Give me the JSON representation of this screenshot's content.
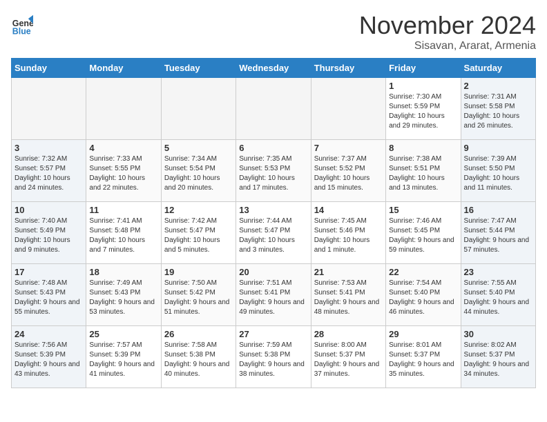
{
  "logo": {
    "line1": "General",
    "line2": "Blue"
  },
  "title": "November 2024",
  "location": "Sisavan, Ararat, Armenia",
  "days_of_week": [
    "Sunday",
    "Monday",
    "Tuesday",
    "Wednesday",
    "Thursday",
    "Friday",
    "Saturday"
  ],
  "weeks": [
    [
      {
        "day": "",
        "info": "",
        "type": "empty"
      },
      {
        "day": "",
        "info": "",
        "type": "empty"
      },
      {
        "day": "",
        "info": "",
        "type": "empty"
      },
      {
        "day": "",
        "info": "",
        "type": "empty"
      },
      {
        "day": "",
        "info": "",
        "type": "empty"
      },
      {
        "day": "1",
        "info": "Sunrise: 7:30 AM\nSunset: 5:59 PM\nDaylight: 10 hours and 29 minutes.",
        "type": "weekend"
      },
      {
        "day": "2",
        "info": "Sunrise: 7:31 AM\nSunset: 5:58 PM\nDaylight: 10 hours and 26 minutes.",
        "type": "weekend"
      }
    ],
    [
      {
        "day": "3",
        "info": "Sunrise: 7:32 AM\nSunset: 5:57 PM\nDaylight: 10 hours and 24 minutes.",
        "type": "weekend"
      },
      {
        "day": "4",
        "info": "Sunrise: 7:33 AM\nSunset: 5:55 PM\nDaylight: 10 hours and 22 minutes.",
        "type": "weekday"
      },
      {
        "day": "5",
        "info": "Sunrise: 7:34 AM\nSunset: 5:54 PM\nDaylight: 10 hours and 20 minutes.",
        "type": "weekday"
      },
      {
        "day": "6",
        "info": "Sunrise: 7:35 AM\nSunset: 5:53 PM\nDaylight: 10 hours and 17 minutes.",
        "type": "weekday"
      },
      {
        "day": "7",
        "info": "Sunrise: 7:37 AM\nSunset: 5:52 PM\nDaylight: 10 hours and 15 minutes.",
        "type": "weekday"
      },
      {
        "day": "8",
        "info": "Sunrise: 7:38 AM\nSunset: 5:51 PM\nDaylight: 10 hours and 13 minutes.",
        "type": "weekend"
      },
      {
        "day": "9",
        "info": "Sunrise: 7:39 AM\nSunset: 5:50 PM\nDaylight: 10 hours and 11 minutes.",
        "type": "weekend"
      }
    ],
    [
      {
        "day": "10",
        "info": "Sunrise: 7:40 AM\nSunset: 5:49 PM\nDaylight: 10 hours and 9 minutes.",
        "type": "weekend"
      },
      {
        "day": "11",
        "info": "Sunrise: 7:41 AM\nSunset: 5:48 PM\nDaylight: 10 hours and 7 minutes.",
        "type": "weekday"
      },
      {
        "day": "12",
        "info": "Sunrise: 7:42 AM\nSunset: 5:47 PM\nDaylight: 10 hours and 5 minutes.",
        "type": "weekday"
      },
      {
        "day": "13",
        "info": "Sunrise: 7:44 AM\nSunset: 5:47 PM\nDaylight: 10 hours and 3 minutes.",
        "type": "weekday"
      },
      {
        "day": "14",
        "info": "Sunrise: 7:45 AM\nSunset: 5:46 PM\nDaylight: 10 hours and 1 minute.",
        "type": "weekday"
      },
      {
        "day": "15",
        "info": "Sunrise: 7:46 AM\nSunset: 5:45 PM\nDaylight: 9 hours and 59 minutes.",
        "type": "weekend"
      },
      {
        "day": "16",
        "info": "Sunrise: 7:47 AM\nSunset: 5:44 PM\nDaylight: 9 hours and 57 minutes.",
        "type": "weekend"
      }
    ],
    [
      {
        "day": "17",
        "info": "Sunrise: 7:48 AM\nSunset: 5:43 PM\nDaylight: 9 hours and 55 minutes.",
        "type": "weekend"
      },
      {
        "day": "18",
        "info": "Sunrise: 7:49 AM\nSunset: 5:43 PM\nDaylight: 9 hours and 53 minutes.",
        "type": "weekday"
      },
      {
        "day": "19",
        "info": "Sunrise: 7:50 AM\nSunset: 5:42 PM\nDaylight: 9 hours and 51 minutes.",
        "type": "weekday"
      },
      {
        "day": "20",
        "info": "Sunrise: 7:51 AM\nSunset: 5:41 PM\nDaylight: 9 hours and 49 minutes.",
        "type": "weekday"
      },
      {
        "day": "21",
        "info": "Sunrise: 7:53 AM\nSunset: 5:41 PM\nDaylight: 9 hours and 48 minutes.",
        "type": "weekday"
      },
      {
        "day": "22",
        "info": "Sunrise: 7:54 AM\nSunset: 5:40 PM\nDaylight: 9 hours and 46 minutes.",
        "type": "weekend"
      },
      {
        "day": "23",
        "info": "Sunrise: 7:55 AM\nSunset: 5:40 PM\nDaylight: 9 hours and 44 minutes.",
        "type": "weekend"
      }
    ],
    [
      {
        "day": "24",
        "info": "Sunrise: 7:56 AM\nSunset: 5:39 PM\nDaylight: 9 hours and 43 minutes.",
        "type": "weekend"
      },
      {
        "day": "25",
        "info": "Sunrise: 7:57 AM\nSunset: 5:39 PM\nDaylight: 9 hours and 41 minutes.",
        "type": "weekday"
      },
      {
        "day": "26",
        "info": "Sunrise: 7:58 AM\nSunset: 5:38 PM\nDaylight: 9 hours and 40 minutes.",
        "type": "weekday"
      },
      {
        "day": "27",
        "info": "Sunrise: 7:59 AM\nSunset: 5:38 PM\nDaylight: 9 hours and 38 minutes.",
        "type": "weekday"
      },
      {
        "day": "28",
        "info": "Sunrise: 8:00 AM\nSunset: 5:37 PM\nDaylight: 9 hours and 37 minutes.",
        "type": "weekday"
      },
      {
        "day": "29",
        "info": "Sunrise: 8:01 AM\nSunset: 5:37 PM\nDaylight: 9 hours and 35 minutes.",
        "type": "weekend"
      },
      {
        "day": "30",
        "info": "Sunrise: 8:02 AM\nSunset: 5:37 PM\nDaylight: 9 hours and 34 minutes.",
        "type": "weekend"
      }
    ]
  ]
}
